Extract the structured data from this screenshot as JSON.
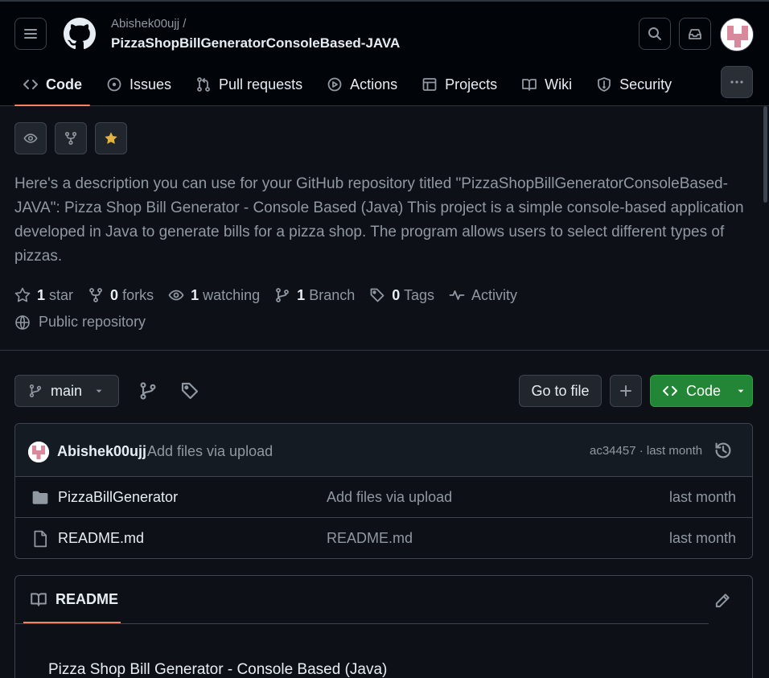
{
  "header": {
    "owner": "Abishek00ujj /",
    "repo_name": "PizzaShopBillGeneratorConsoleBased-JAVA"
  },
  "tabs": [
    {
      "label": "Code",
      "icon": "code-icon",
      "selected": true
    },
    {
      "label": "Issues",
      "icon": "issue-icon"
    },
    {
      "label": "Pull requests",
      "icon": "pull-request-icon"
    },
    {
      "label": "Actions",
      "icon": "play-icon"
    },
    {
      "label": "Projects",
      "icon": "table-icon"
    },
    {
      "label": "Wiki",
      "icon": "book-icon"
    },
    {
      "label": "Security",
      "icon": "shield-icon"
    }
  ],
  "description": "Here's a description you can use for your GitHub repository titled \"PizzaShopBillGeneratorConsoleBased-JAVA\": Pizza Shop Bill Generator - Console Based (Java) This project is a simple console-based application developed in Java to generate bills for a pizza shop. The program allows users to select different types of pizzas.",
  "stats": {
    "stars_count": "1",
    "stars_label": "star",
    "forks_count": "0",
    "forks_label": "forks",
    "watching_count": "1",
    "watching_label": "watching",
    "branch_count": "1",
    "branch_label": "Branch",
    "tags_count": "0",
    "tags_label": "Tags",
    "activity_label": "Activity"
  },
  "visibility": "Public repository",
  "toolbar": {
    "branch": "main",
    "goto_file": "Go to file",
    "code_label": "Code"
  },
  "latest_commit": {
    "author": "Abishek00ujj",
    "message": "Add files via upload",
    "meta": "ac34457 · last month"
  },
  "files": [
    {
      "name": "PizzaBillGenerator",
      "type": "folder",
      "message": "Add files via upload",
      "date": "last month"
    },
    {
      "name": "README.md",
      "type": "file",
      "message": "README.md",
      "date": "last month"
    }
  ],
  "readme": {
    "tab_label": "README",
    "heading": "Pizza Shop Bill Generator - Console Based (Java)"
  },
  "colors": {
    "background": "#0d1117",
    "header_background": "#010409",
    "accent_underline": "#f78166",
    "code_button": "#238636",
    "star": "#e3b341"
  }
}
